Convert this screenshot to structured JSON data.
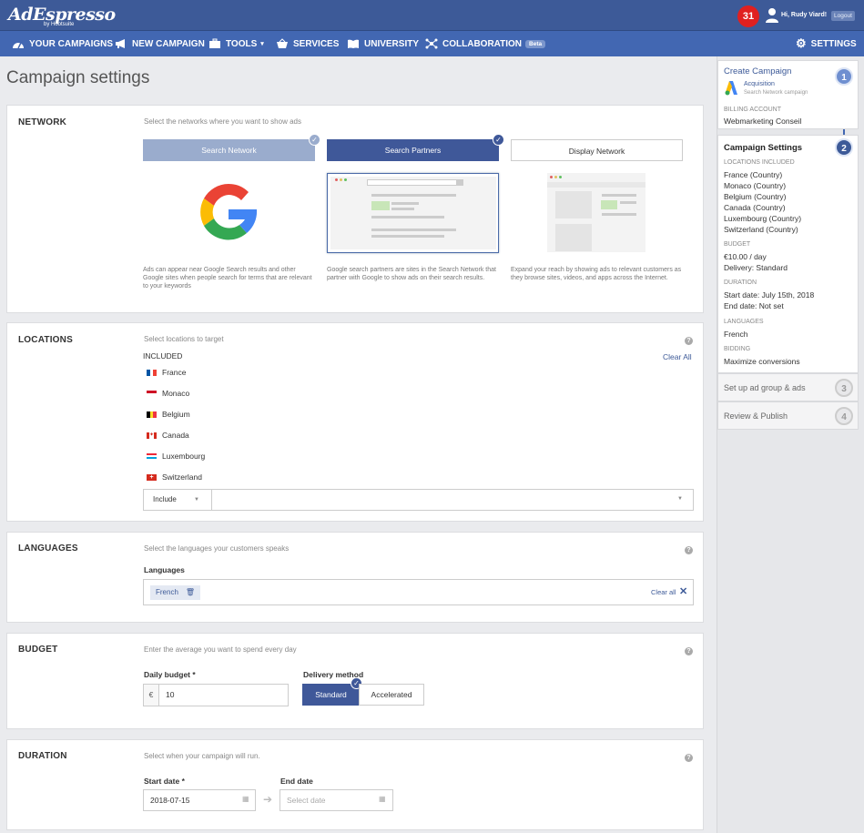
{
  "header": {
    "logo": "AdEspresso",
    "logo_sub": "by Hootsuite",
    "notifications": "31",
    "greeting": "Hi, Rudy Viard!",
    "logout": "Logout"
  },
  "nav": {
    "your_campaigns": "YOUR CAMPAIGNS",
    "new_campaign": "NEW CAMPAIGN",
    "tools": "TOOLS",
    "services": "SERVICES",
    "university": "UNIVERSITY",
    "collaboration": "COLLABORATION",
    "beta": "Beta",
    "settings": "SETTINGS"
  },
  "page_title": "Campaign settings",
  "network": {
    "title": "NETWORK",
    "desc": "Select the networks where you want to show ads",
    "search_network": "Search Network",
    "search_partners": "Search Partners",
    "display_network": "Display Network",
    "search_network_desc": "Ads can appear near Google Search results and other Google sites when people search for terms that are relevant to your keywords",
    "search_partners_desc": "Google search partners are sites in the Search Network that partner with Google to show ads on their search results.",
    "display_network_desc": "Expand your reach by showing ads to relevant customers as they browse sites, videos, and apps across the Internet."
  },
  "locations": {
    "title": "LOCATIONS",
    "desc": "Select locations to target",
    "included": "INCLUDED",
    "clear_all": "Clear All",
    "items": [
      "France",
      "Monaco",
      "Belgium",
      "Canada",
      "Luxembourg",
      "Switzerland"
    ],
    "include_select": "Include"
  },
  "languages": {
    "title": "LANGUAGES",
    "desc": "Select the languages your customers speaks",
    "label": "Languages",
    "tag": "French",
    "clear_all": "Clear all"
  },
  "budget": {
    "title": "BUDGET",
    "desc": "Enter the average you want to spend every day",
    "daily_label": "Daily budget *",
    "currency": "€",
    "value": "10",
    "delivery_label": "Delivery method",
    "standard": "Standard",
    "accelerated": "Accelerated"
  },
  "duration": {
    "title": "DURATION",
    "desc": "Select when your campaign will run.",
    "start_label": "Start date *",
    "start_value": "2018-07-15",
    "end_label": "End date",
    "end_placeholder": "Select date"
  },
  "sidebar": {
    "step1_title": "Create Campaign",
    "step1_sub": "Acquisition",
    "step1_sub2": "Search Network campaign",
    "billing_label": "BILLING ACCOUNT",
    "billing_value": "Webmarketing Conseil",
    "step2_title": "Campaign Settings",
    "locations_label": "LOCATIONS INCLUDED",
    "locations": [
      "France (Country)",
      "Monaco (Country)",
      "Belgium (Country)",
      "Canada (Country)",
      "Luxembourg (Country)",
      "Switzerland (Country)"
    ],
    "budget_label": "BUDGET",
    "budget_value": "€10.00 / day",
    "delivery_value": "Delivery: Standard",
    "duration_label": "DURATION",
    "start_value": "Start date:  July 15th, 2018",
    "end_value": "End date:  Not set",
    "languages_label": "LANGUAGES",
    "languages_value": "French",
    "bidding_label": "BIDDING",
    "bidding_value": "Maximize conversions",
    "step3": "Set up ad group & ads",
    "step4": "Review & Publish",
    "num1": "1",
    "num2": "2",
    "num3": "3",
    "num4": "4"
  }
}
